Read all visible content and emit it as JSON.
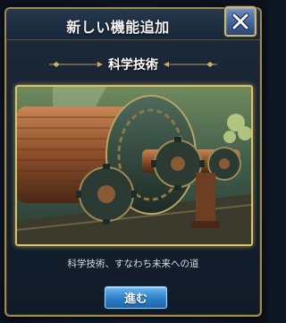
{
  "dialog": {
    "title": "新しい機能追加",
    "close_icon": "close-x-icon",
    "feature_name": "科学技術",
    "illustration_icon": "bronze-machinery-illustration",
    "caption": "科学技術、すなわち未来への道",
    "proceed_label": "進む"
  },
  "colors": {
    "accent_gold": "#d9c26a",
    "button_blue": "#2d7fc9",
    "close_blue": "#4f6fa5"
  }
}
